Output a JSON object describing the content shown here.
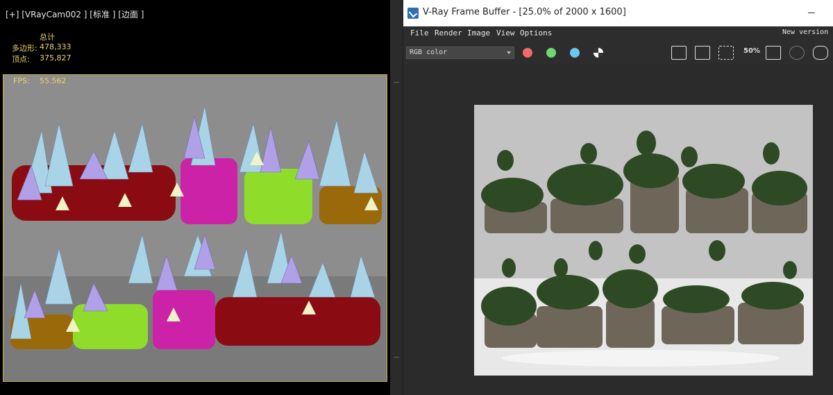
{
  "viewport": {
    "header": "[+] [VRayCam002 ] [标准 ] [边面 ]",
    "stats": {
      "total_label": "总计",
      "poly_label": "多边形:",
      "poly_value": "478,333",
      "vert_label": "顶点:",
      "vert_value": "375,827",
      "fps_label": "FPS:",
      "fps_value": "55.562"
    }
  },
  "framebuffer": {
    "title": "V-Ray Frame Buffer - [25.0% of 2000 x 1600]",
    "menu": [
      "File",
      "Render",
      "Image",
      "View",
      "Options"
    ],
    "new_version": "New version",
    "channel": "RGB color",
    "zoom_label": "50%",
    "colors": {
      "red": "#ef6b6b",
      "green": "#6fd86f",
      "blue": "#6cc7ef"
    }
  }
}
